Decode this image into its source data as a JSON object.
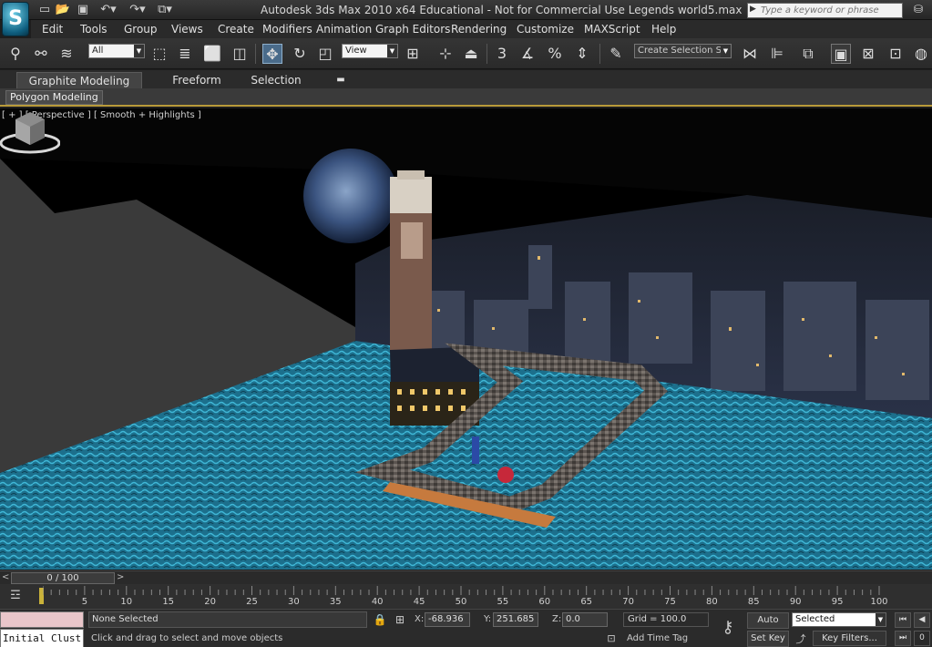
{
  "window": {
    "title": "Autodesk 3ds Max  2010 x64   Educational - Not for Commercial Use    Legends world5.max",
    "search_placeholder": "Type a keyword or phrase"
  },
  "menu": [
    "Edit",
    "Tools",
    "Group",
    "Views",
    "Create",
    "Modifiers",
    "Animation",
    "Graph Editors",
    "Rendering",
    "Customize",
    "MAXScript",
    "Help"
  ],
  "toolbar": {
    "selection_filter": "All",
    "reference_coord": "View",
    "named_selection_placeholder": "Create Selection Se",
    "snap_labels": [
      "3",
      "%"
    ]
  },
  "ribbon": {
    "tabs": [
      "Graphite Modeling Tools",
      "Freeform",
      "Selection"
    ],
    "panel_button": "Polygon Modeling"
  },
  "viewport": {
    "label": "[ + ] [ Perspective ] [ Smooth + Highlights ]"
  },
  "timeline": {
    "frame_display": "0 / 100",
    "tick_labels": [
      "5",
      "10",
      "15",
      "20",
      "25",
      "30",
      "35",
      "40",
      "45",
      "50",
      "55",
      "60",
      "65",
      "70",
      "75",
      "80",
      "85",
      "90",
      "95",
      "100"
    ]
  },
  "status": {
    "maxscript_listener": "Initial Clust",
    "selection": "None Selected",
    "prompt": "Click and drag to select and move objects",
    "x_label": "X:",
    "x": "-68.936",
    "y_label": "Y:",
    "y": "251.685",
    "z_label": "Z:",
    "z": "0.0",
    "grid": "Grid = 100.0",
    "add_time_tag": "Add Time Tag",
    "auto_key": "Auto Key",
    "set_key": "Set Key",
    "key_mode": "Selected",
    "key_filters": "Key Filters...",
    "frame_field": "0"
  }
}
